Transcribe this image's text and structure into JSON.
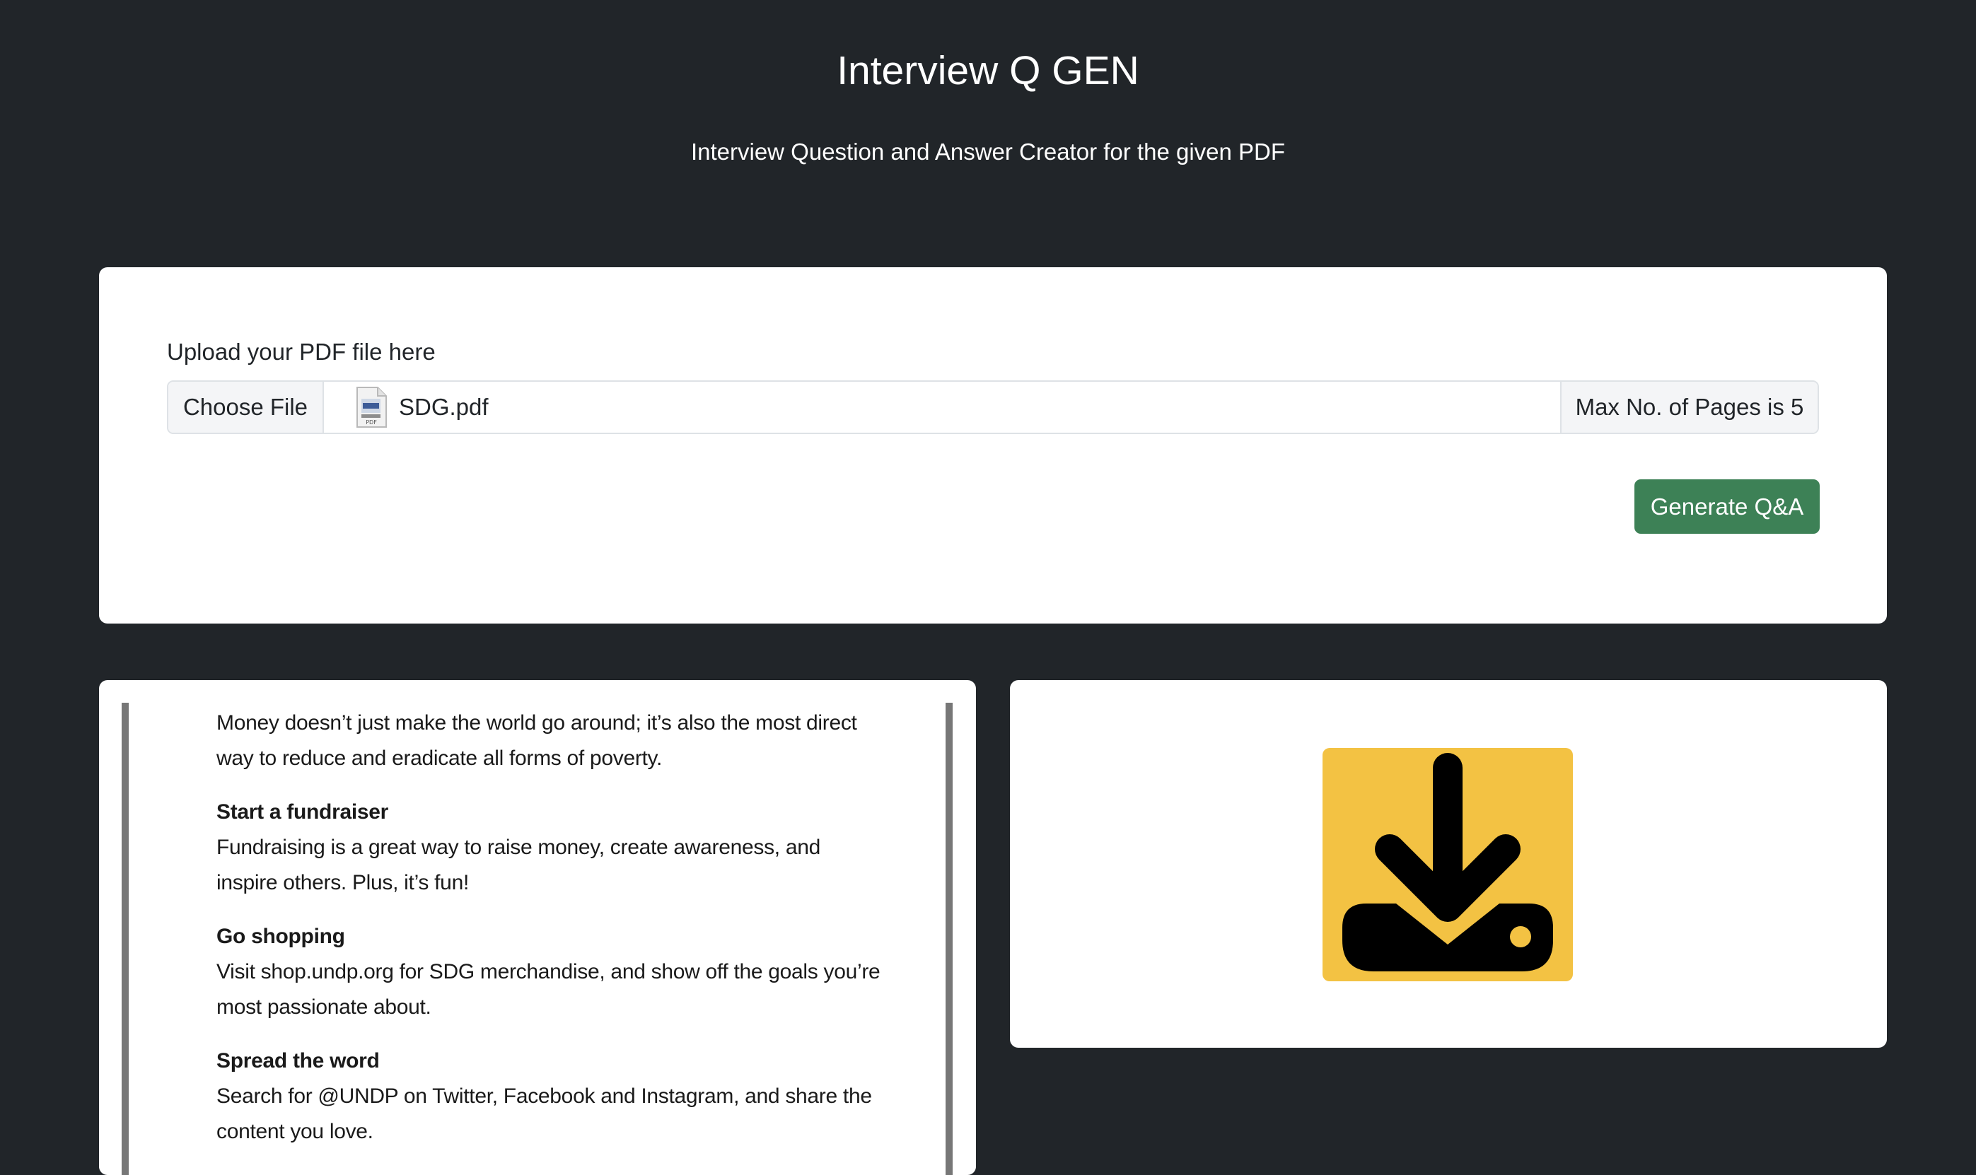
{
  "header": {
    "title": "Interview Q GEN",
    "subtitle": "Interview Question and Answer Creator for the given PDF"
  },
  "upload": {
    "label": "Upload your PDF file here",
    "choose_file_label": "Choose File",
    "file_name": "SDG.pdf",
    "file_icon": "pdf-file-icon",
    "max_pages_label": "Max No. of Pages is 5",
    "generate_label": "Generate Q&A"
  },
  "pdf_preview": {
    "intro": "Money doesn’t just make the world go around; it’s also the most direct way to reduce and eradicate all forms of poverty.",
    "items": [
      {
        "heading": "Start a fundraiser",
        "body": "Fundraising is a great way to raise money, create awareness, and inspire others. Plus, it’s fun!"
      },
      {
        "heading": "Go shopping",
        "body": "Visit shop.undp.org for SDG merchandise, and show off the goals you’re most passionate about."
      },
      {
        "heading": "Spread the word",
        "body": "Search for @UNDP on Twitter, Facebook and Instagram, and share the content you love."
      }
    ]
  },
  "download": {
    "icon": "download-icon",
    "icon_bg_color": "#f3c243",
    "icon_fg_color": "#000000"
  },
  "colors": {
    "page_bg": "#212529",
    "card_bg": "#ffffff",
    "button_green": "#3d8156"
  }
}
